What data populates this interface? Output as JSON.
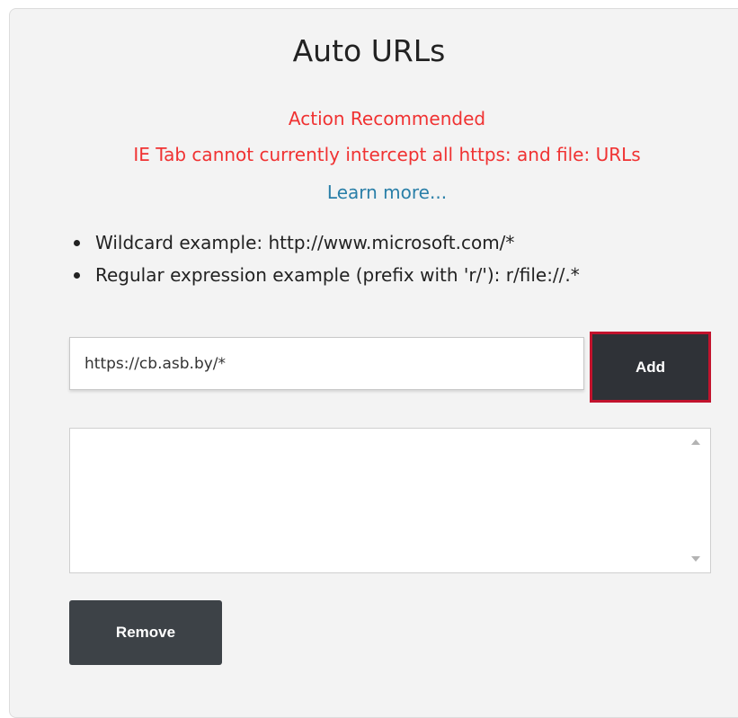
{
  "page": {
    "title": "Auto URLs"
  },
  "warning": {
    "heading": "Action Recommended",
    "message": "IE Tab cannot currently intercept all https: and file: URLs",
    "learn_more": "Learn more..."
  },
  "examples": [
    {
      "text": "Wildcard example: http://www.microsoft.com/*"
    },
    {
      "text": "Regular expression example (prefix with 'r/'): r/file://.*"
    }
  ],
  "url_input": {
    "value": "https://cb.asb.by/*",
    "add_label": "Add"
  },
  "url_list": {
    "items": []
  },
  "remove_label": "Remove",
  "colors": {
    "panel_bg": "#f3f3f3",
    "warning": "#f03232",
    "link": "#2a7fa8",
    "add_button_bg": "#2f3237",
    "add_button_focus_border": "#c2132d",
    "remove_button_bg": "#3d4247"
  }
}
